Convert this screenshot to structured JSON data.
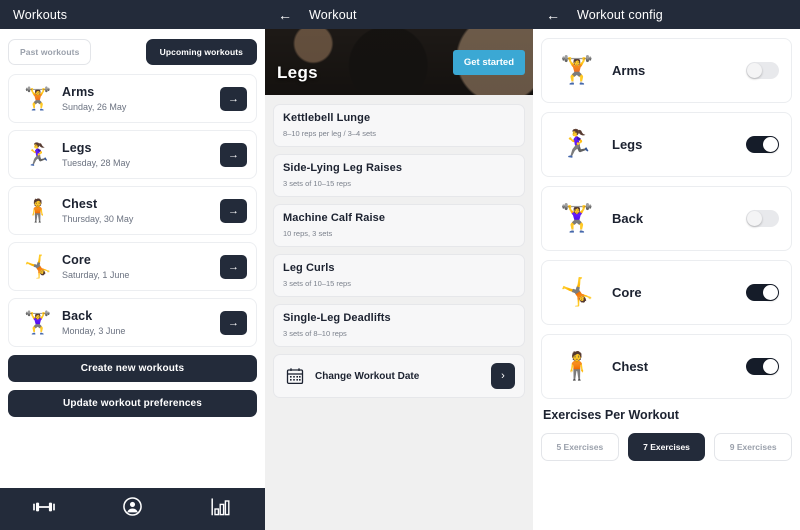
{
  "colors": {
    "header_bg": "#232b3a",
    "accent_dark": "#232b3a",
    "get_started_blue": "#3ba8d4",
    "panel2_bg": "#f0f0f0",
    "muted_text": "#9aa0ab"
  },
  "workouts_screen": {
    "title": "Workouts",
    "segments": [
      {
        "label": "Past workouts",
        "selected": false
      },
      {
        "label": "Upcoming workouts",
        "selected": true
      }
    ],
    "cards": [
      {
        "icon": "weightlifter-icon",
        "emoji": "🏋️",
        "name": "Arms",
        "date": "Sunday, 26 May",
        "arrow": "→"
      },
      {
        "icon": "runner-icon",
        "emoji": "🏃‍♀️",
        "name": "Legs",
        "date": "Tuesday, 28 May",
        "arrow": "→"
      },
      {
        "icon": "standing-person-icon",
        "emoji": "🧍",
        "name": "Chest",
        "date": "Thursday, 30 May",
        "arrow": "→"
      },
      {
        "icon": "situp-icon",
        "emoji": "🤸",
        "name": "Core",
        "date": "Saturday, 1 June",
        "arrow": "→"
      },
      {
        "icon": "barbell-lift-icon",
        "emoji": "🏋️‍♀️",
        "name": "Back",
        "date": "Monday, 3 June",
        "arrow": "→"
      }
    ],
    "primary_buttons": [
      {
        "label": "Create new workouts"
      },
      {
        "label": "Update workout preferences"
      }
    ],
    "tabbar": [
      {
        "icon": "dumbbell-icon",
        "name": "tab-workouts"
      },
      {
        "icon": "account-icon",
        "name": "tab-account"
      },
      {
        "icon": "stats-icon",
        "name": "tab-stats"
      }
    ]
  },
  "workout_screen": {
    "title": "Workout",
    "back_icon": "←",
    "hero": {
      "title": "Legs",
      "cta_label": "Get started"
    },
    "exercises": [
      {
        "name": "Kettlebell Lunge",
        "detail": "8–10 reps per leg / 3–4 sets"
      },
      {
        "name": "Side-Lying Leg Raises",
        "detail": "3 sets of 10–15 reps"
      },
      {
        "name": "Machine Calf Raise",
        "detail": "10 reps, 3 sets"
      },
      {
        "name": "Leg Curls",
        "detail": "3 sets of 10–15 reps"
      },
      {
        "name": "Single-Leg Deadlifts",
        "detail": "3 sets of 8–10 reps"
      }
    ],
    "change_date": {
      "icon": "calendar-icon",
      "label": "Change Workout Date",
      "chevron": "›"
    }
  },
  "config_screen": {
    "title": "Workout config",
    "back_icon": "←",
    "muscle_groups": [
      {
        "icon": "weightlifter-icon",
        "emoji": "🏋️",
        "name": "Arms",
        "enabled": false
      },
      {
        "icon": "runner-icon",
        "emoji": "🏃‍♀️",
        "name": "Legs",
        "enabled": true
      },
      {
        "icon": "barbell-lift-icon",
        "emoji": "🏋️‍♀️",
        "name": "Back",
        "enabled": false
      },
      {
        "icon": "situp-icon",
        "emoji": "🤸",
        "name": "Core",
        "enabled": true
      },
      {
        "icon": "standing-person-icon",
        "emoji": "🧍",
        "name": "Chest",
        "enabled": true
      }
    ],
    "exercises_per_workout": {
      "heading": "Exercises Per Workout",
      "options": [
        {
          "label": "5 Exercises",
          "selected": false
        },
        {
          "label": "7 Exercises",
          "selected": true
        },
        {
          "label": "9 Exercises",
          "selected": false
        }
      ]
    }
  }
}
